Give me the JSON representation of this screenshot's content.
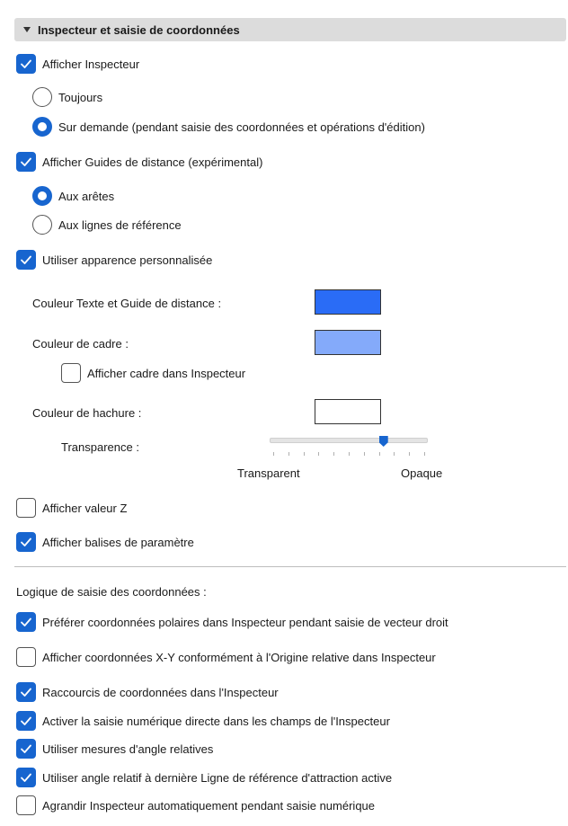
{
  "section": {
    "title": "Inspecteur et saisie de coordonnées"
  },
  "options": {
    "afficher_inspecteur": {
      "label": "Afficher Inspecteur",
      "checked": true
    },
    "toujours": {
      "label": "Toujours",
      "selected": false
    },
    "sur_demande": {
      "label": "Sur demande (pendant saisie des coordonnées et opérations d'édition)",
      "selected": true
    },
    "guides_distance": {
      "label": "Afficher Guides de distance (expérimental)",
      "checked": true
    },
    "aux_aretes": {
      "label": "Aux arêtes",
      "selected": true
    },
    "aux_lignes": {
      "label": "Aux lignes de référence",
      "selected": false
    },
    "apparence_perso": {
      "label": "Utiliser apparence personnalisée",
      "checked": true
    }
  },
  "appearance": {
    "couleur_texte_label": "Couleur Texte et Guide de distance :",
    "couleur_texte_color": "#2a6cf6",
    "couleur_cadre_label": "Couleur de cadre :",
    "couleur_cadre_color": "#84aafa",
    "afficher_cadre": {
      "label": "Afficher cadre dans Inspecteur",
      "checked": false
    },
    "couleur_hachure_label": "Couleur de hachure :",
    "couleur_hachure_color": "#ffffff",
    "transparence_label": "Transparence :",
    "transparence_value": 0.72,
    "transparent_label": "Transparent",
    "opaque_label": "Opaque"
  },
  "display": {
    "valeur_z": {
      "label": "Afficher valeur Z",
      "checked": false
    },
    "balises": {
      "label": "Afficher balises de paramètre",
      "checked": true
    }
  },
  "logic": {
    "title": "Logique de saisie des coordonnées :",
    "items": [
      {
        "label": "Préférer coordonnées polaires dans Inspecteur pendant saisie de vecteur droit",
        "checked": true
      },
      {
        "label": "Afficher coordonnées X-Y conformément à l'Origine relative dans Inspecteur",
        "checked": false
      },
      {
        "label": "Raccourcis de coordonnées dans l'Inspecteur",
        "checked": true
      },
      {
        "label": "Activer la saisie numérique directe dans les champs de l'Inspecteur",
        "checked": true
      },
      {
        "label": "Utiliser mesures d'angle relatives",
        "checked": true
      },
      {
        "label": "Utiliser angle relatif à dernière Ligne de référence d'attraction active",
        "checked": true
      },
      {
        "label": "Agrandir Inspecteur automatiquement pendant saisie numérique",
        "checked": false
      }
    ]
  },
  "colors": {
    "accent": "#1765cf"
  }
}
